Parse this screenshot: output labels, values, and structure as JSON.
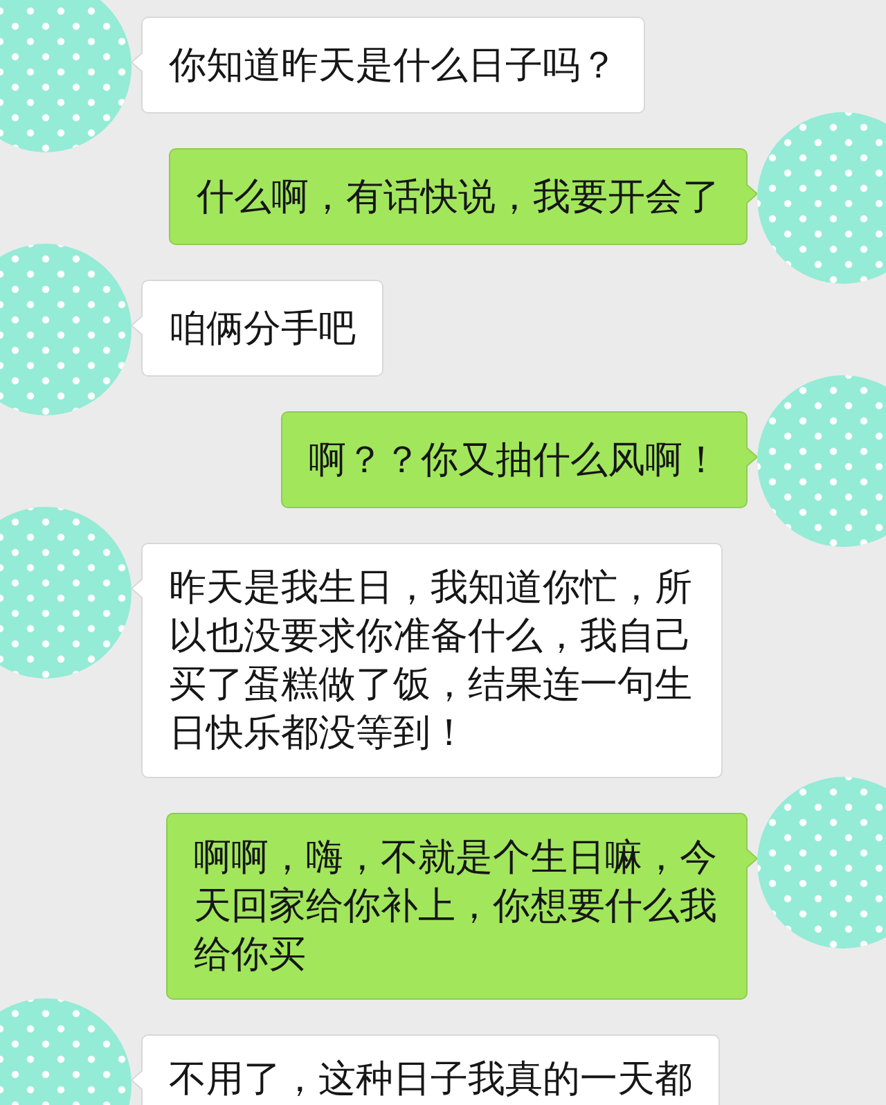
{
  "messages": [
    {
      "kind": "received",
      "text": "你知道昨天是什么日子吗？"
    },
    {
      "kind": "sent",
      "text": "什么啊，有话快说，我要开会了"
    },
    {
      "kind": "received",
      "text": "咱俩分手吧"
    },
    {
      "kind": "sent",
      "text": "啊？？你又抽什么风啊！"
    },
    {
      "kind": "received",
      "text": "昨天是我生日，我知道你忙，所以也没要求你准备什么，我自己买了蛋糕做了饭，结果连一句生日快乐都没等到！"
    },
    {
      "kind": "sent",
      "text": "啊啊，嗨，不就是个生日嘛，今天回家给你补上，你想要什么我给你买"
    },
    {
      "kind": "received",
      "text": "不用了，这种日子我真的一天都"
    }
  ]
}
